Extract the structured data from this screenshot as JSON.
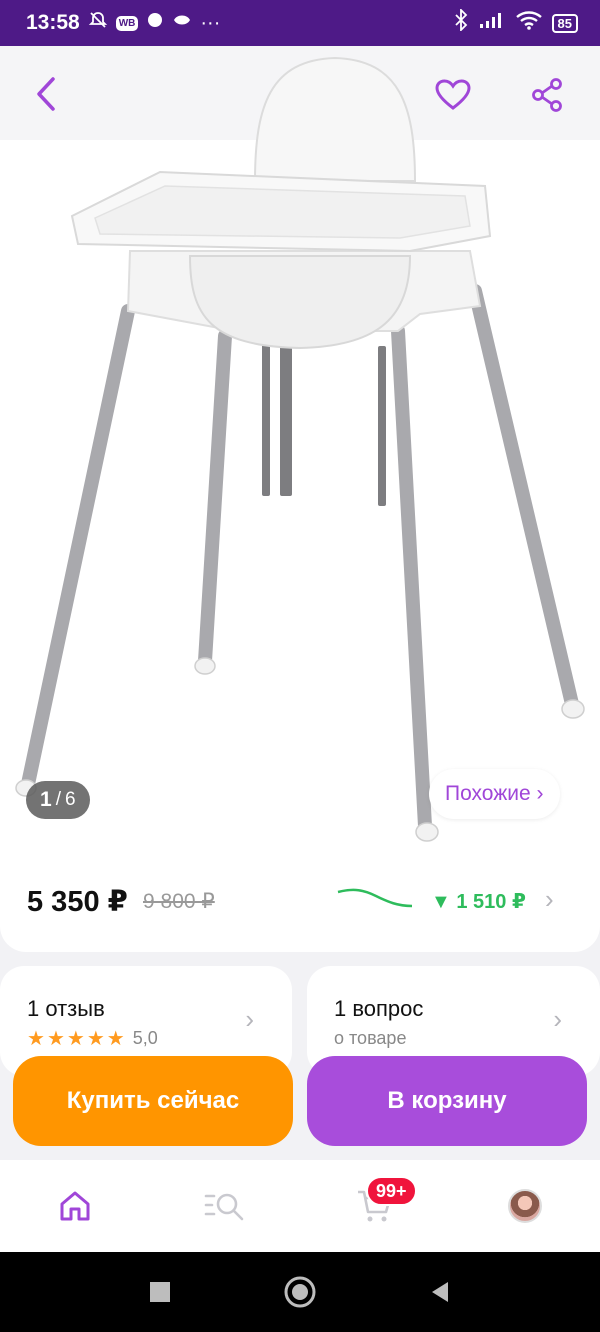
{
  "status_bar": {
    "time": "13:58",
    "app_badge": "WB",
    "dots": "···",
    "battery": "85"
  },
  "gallery": {
    "current": "1",
    "separator": "/",
    "total": "6",
    "similar_label": "Похожие ›"
  },
  "price": {
    "current": "5 350 ₽",
    "old": "9 800 ₽",
    "drop": "▼ 1 510 ₽"
  },
  "reviews": {
    "title": "1 отзыв",
    "stars": 5,
    "rating": "5,0"
  },
  "questions": {
    "title": "1 вопрос",
    "subtitle": "о товаре"
  },
  "actions": {
    "buy_label": "Купить сейчас",
    "cart_label": "В корзину"
  },
  "nav": {
    "cart_badge": "99+"
  },
  "colors": {
    "accent": "#a84ddb",
    "buy": "#ff9500",
    "status_bar": "#4e1a87",
    "price_drop": "#2ebc5c",
    "badge": "#f0143c"
  },
  "icons": [
    "back-arrow-icon",
    "heart-icon",
    "share-icon",
    "chevron-right-icon",
    "home-icon",
    "catalog-search-icon",
    "cart-icon",
    "profile-avatar-icon"
  ]
}
